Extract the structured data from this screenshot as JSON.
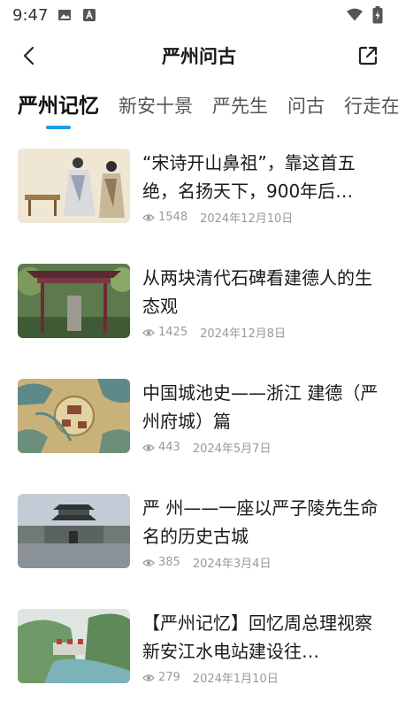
{
  "status": {
    "time": "9:47"
  },
  "header": {
    "title": "严州问古"
  },
  "tabs": [
    {
      "label": "严州记忆",
      "active": true
    },
    {
      "label": "新安十景",
      "active": false
    },
    {
      "label": "严先生",
      "active": false
    },
    {
      "label": "问古",
      "active": false
    },
    {
      "label": "行走在",
      "active": false
    }
  ],
  "articles": [
    {
      "title": "“宋诗开山鼻祖”，靠这首五绝，名扬天下，900年后…",
      "views": "1548",
      "date": "2024年12月10日"
    },
    {
      "title": "从两块清代石碑看建德人的生态观",
      "views": "1425",
      "date": "2024年12月8日"
    },
    {
      "title": "中国城池史——浙江 建德（严州府城）篇",
      "views": "443",
      "date": "2024年5月7日"
    },
    {
      "title": "严 州——一座以严子陵先生命名的历史古城",
      "views": "385",
      "date": "2024年3月4日"
    },
    {
      "title": "【严州记忆】回忆周总理视察新安江水电站建设往…",
      "views": "279",
      "date": "2024年1月10日"
    }
  ],
  "colors": {
    "accent": "#1e9be8",
    "meta": "#999999"
  }
}
